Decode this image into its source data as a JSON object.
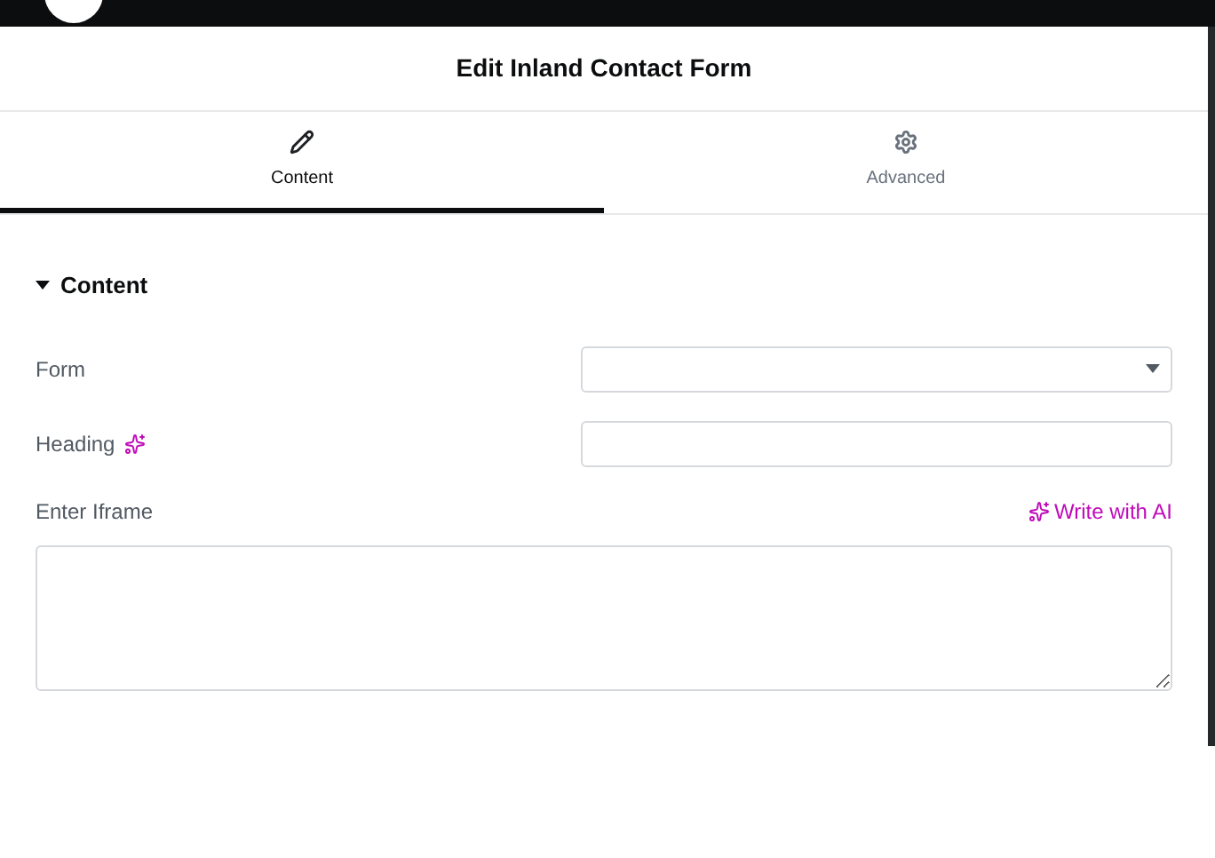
{
  "panel": {
    "title": "Edit Inland Contact Form"
  },
  "tabs": [
    {
      "label": "Content",
      "kind": "edit",
      "selected": true
    },
    {
      "label": "Advanced",
      "kind": "settings",
      "selected": false
    }
  ],
  "section": {
    "title": "Content",
    "expanded": true
  },
  "fields": [
    {
      "kind": "select",
      "label": "Form",
      "ai": false
    },
    {
      "kind": "text",
      "label": "Heading",
      "ai": true
    },
    {
      "kind": "textarea",
      "label": "Enter Iframe",
      "action": "Write with AI"
    }
  ]
}
